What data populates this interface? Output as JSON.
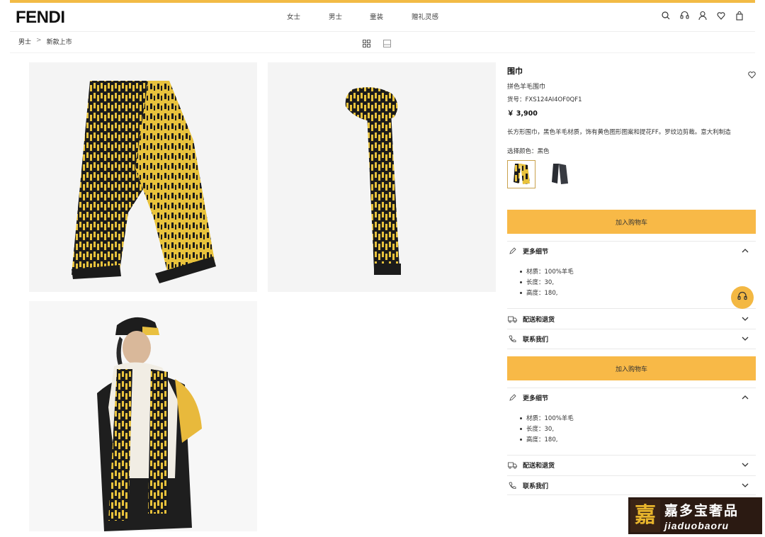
{
  "header": {
    "logo": "FENDI",
    "nav": [
      "女士",
      "男士",
      "童装",
      "赠礼灵感"
    ],
    "icons": [
      "search-icon",
      "headset-icon",
      "user-icon",
      "heart-icon",
      "bag-icon"
    ],
    "accent_color": "#f2bb45"
  },
  "breadcrumb": {
    "items": [
      "男士",
      "新款上市"
    ],
    "separator": ">"
  },
  "view_toggles": [
    "grid-view-icon",
    "single-view-icon"
  ],
  "gallery": {
    "images": [
      "scarf-flat-image",
      "scarf-hanging-image",
      "model-wearing-scarf-image"
    ],
    "pattern_colors": {
      "yellow": "#e8c23c",
      "black": "#1b1b1b"
    }
  },
  "product": {
    "title": "围巾",
    "subtitle": "拼色羊毛围巾",
    "sku": "货号：FXS124AI4OF0QF1",
    "price": "￥ 3,900",
    "description": "长方形围巾，黑色羊毛材质，饰有黄色图形图案和提花FF。罗纹边剪裁。意大利制造",
    "color_label": "选择颜色：黑色",
    "swatches": [
      {
        "name": "black-yellow",
        "selected": true
      },
      {
        "name": "black",
        "selected": false
      }
    ]
  },
  "cart": {
    "label": "加入购物车",
    "color": "#f8b947"
  },
  "details": {
    "title": "更多细节",
    "items": [
      "材质：100%羊毛",
      "长度：30,",
      "高度：180,"
    ]
  },
  "shipping": {
    "title": "配送和退货"
  },
  "contact": {
    "title": "联系我们"
  },
  "watermark": {
    "seal": "嘉",
    "cn": "嘉多宝奢品",
    "en": "jiaduobaoru"
  }
}
